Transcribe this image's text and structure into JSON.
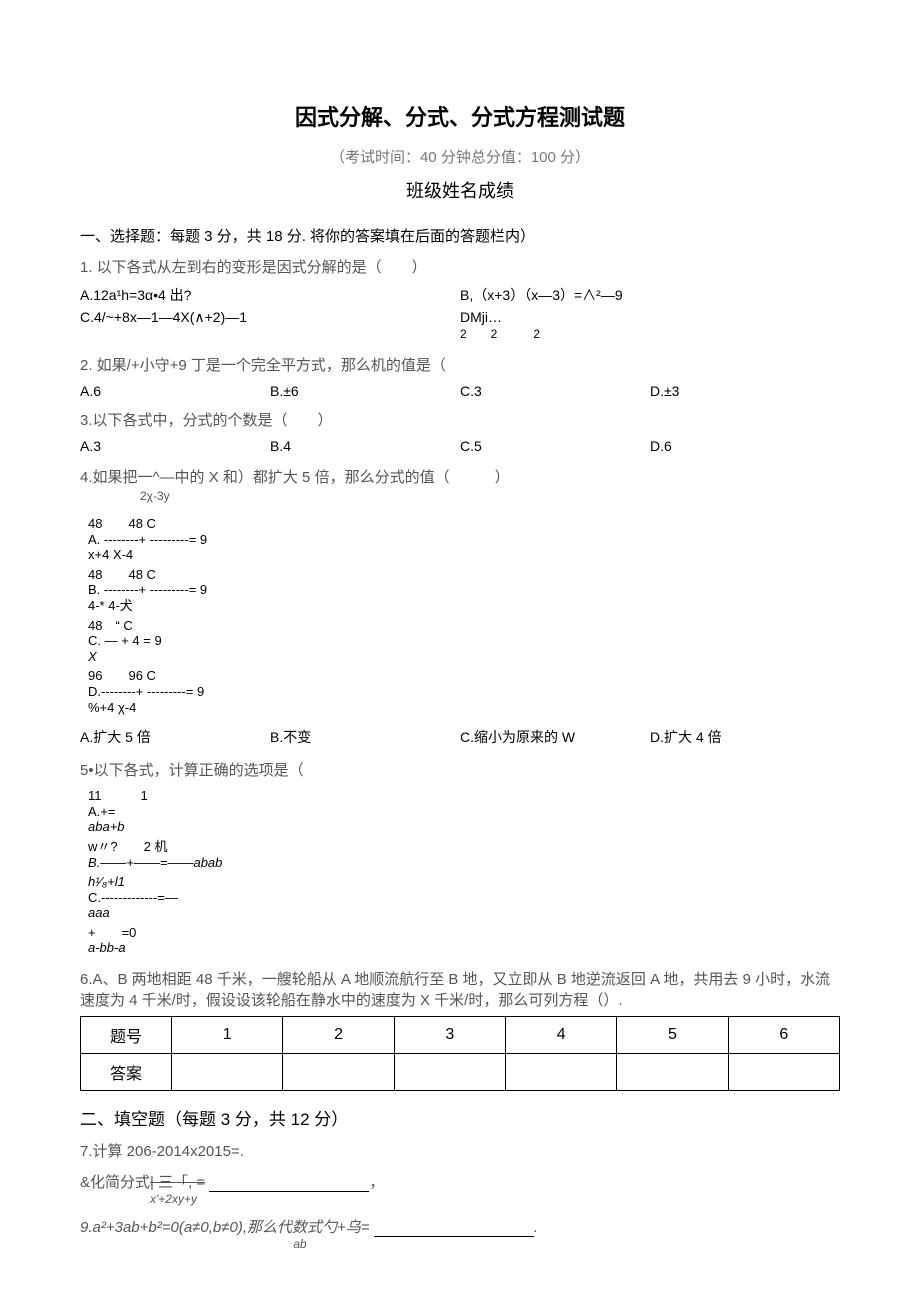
{
  "title": "因式分解、分式、分式方程测试题",
  "exam_info": "（考试时间：40 分钟总分值：100 分）",
  "header_fields": "班级姓名成绩",
  "section1_head": "一、选择题：每题 3 分，共 18 分. 将你的答案填在后面的答题栏内）",
  "q1": {
    "stem": "1. 以下各式从左到右的变形是因式分解的是（　　）",
    "A": "A.12a¹h=3α•4 出?",
    "B": "B,（x+3）（x—3）=∧²—9",
    "C": "C.4/~+8x—1—4X(∧+2)—1",
    "D": "DMji…",
    "D_sub": "2　　2　　　2"
  },
  "q2": {
    "stem": "2. 如果/+小守+9 丁是一个完全平方式，那么机的值是（",
    "A": "A.6",
    "B": "B.±6",
    "C": "C.3",
    "D": "D.±3"
  },
  "q3": {
    "stem": "3.以下各式中，分式的个数是（　　）",
    "A": "A.3",
    "B": "B.4",
    "C": "C.5",
    "D": "D.6"
  },
  "q4": {
    "stem": "4.如果把一^—中的 X 和）都扩大 5 倍，那么分式的值（　　　）",
    "stem_sub": "2χ-3y",
    "qA_top": "48　　48 C",
    "qA_mid": "A. --------+ ---------= 9",
    "qA_bot": "x+4 X-4",
    "qB_top": "48　　48 C",
    "qB_mid": "B. --------+ ---------= 9",
    "qB_bot": "4-* 4-犬",
    "qC_top": "48　“ C",
    "qC_mid": "C. — + 4 = 9",
    "qC_bot": "X",
    "qD_top": "96　　96 C",
    "qD_mid": "D.--------+ ---------= 9",
    "qD_bot": "%+4 χ-4",
    "A2": "A.扩大 5 倍",
    "B2": "B.不变",
    "C2": "C.缩小为原来的 W",
    "D2": "D.扩大 4 倍"
  },
  "q5": {
    "stem": "5•以下各式，计算正确的选项是（",
    "At": "11　　　1",
    "Am": "A.+=",
    "Ab": "aba+b",
    "Bt": "w〃?　　2 机",
    "Bm": "B.——+——=——abab",
    "Ct": "h¹⁄₈+l1",
    "Cm": "C.-------------=—",
    "Cb": "aaa",
    "Dt": "+　　=0",
    "Db": "a-bb-a"
  },
  "q6": "6.A、B 两地相距 48 千米，一艘轮船从 A 地顺流航行至 B 地，又立即从 B 地逆流返回 A 地，共用去 9 小时，水流速度为 4 千米/时，假设设该轮船在静水中的速度为 X 千米/时，那么可列方程（）.",
  "table": {
    "row1_label": "题号",
    "cols": [
      "1",
      "2",
      "3",
      "4",
      "5",
      "6"
    ],
    "row2_label": "答案"
  },
  "section2_head": "二、填空题（每题 3 分，共 12 分）",
  "q7": "7.计算 206-2014x2015=.",
  "q8": {
    "line1_pre": "&化简分式",
    "line1_strike": "| 三「, =",
    "line1_tail": "，",
    "line2": "x'+2xy+y"
  },
  "q9": {
    "main": "9.a²+3ab+b²=0(a≠0,b≠0),那么代数式勺+乌= ",
    "tail": ".",
    "sub": "ab"
  }
}
